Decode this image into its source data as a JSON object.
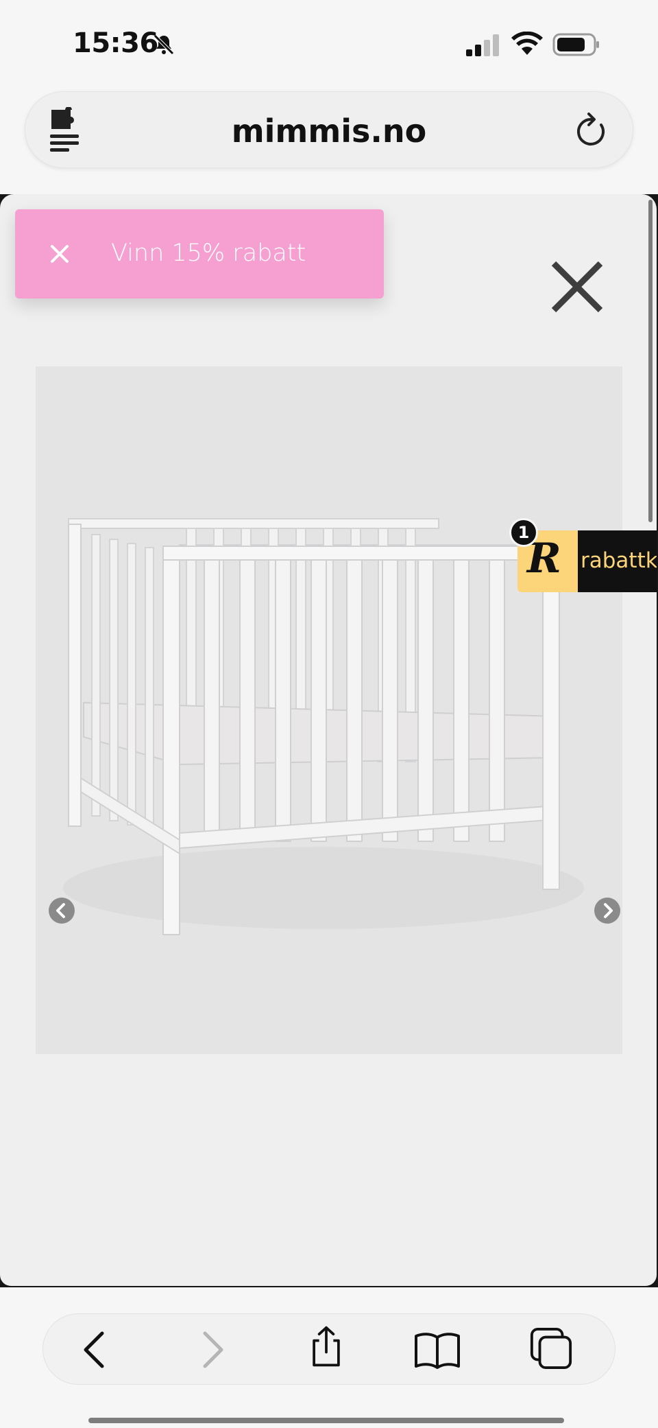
{
  "status_bar": {
    "time": "15:36",
    "icons": [
      "bell-slash-icon",
      "cellular-signal-icon",
      "wifi-icon",
      "battery-icon"
    ]
  },
  "browser": {
    "url": "mimmis.no",
    "left_icon": "extension-icon",
    "right_icon": "reload-icon"
  },
  "promo": {
    "text": "Vinn 15% rabatt",
    "close_icon": "close-icon",
    "background": "#f6a0d2"
  },
  "modal": {
    "close_icon": "close-icon",
    "image_alt_icon": "crib-image",
    "prev_icon": "chevron-left-icon",
    "next_icon": "chevron-right-icon"
  },
  "rabatt_widget": {
    "badge_count": "1",
    "logo_letter": "R",
    "label": "rabattkod",
    "accent": "#fcd57a"
  },
  "toolbar": {
    "icons": [
      "back-icon",
      "forward-icon",
      "share-icon",
      "bookmarks-icon",
      "tabs-icon"
    ]
  }
}
